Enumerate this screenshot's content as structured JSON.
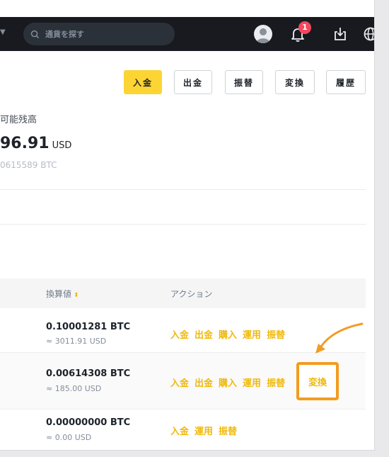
{
  "nav": {
    "search_placeholder": "通貨を探す",
    "notification_count": "1"
  },
  "actions_bar": {
    "deposit": "入金",
    "withdraw": "出金",
    "transfer": "振替",
    "convert": "変換",
    "history": "履歴"
  },
  "balance": {
    "label": "可能残高",
    "value": "96.91",
    "unit": "USD",
    "btc": "0615589 BTC"
  },
  "table": {
    "headers": {
      "converted": "換算値",
      "action": "アクション"
    },
    "rows": [
      {
        "btc": "0.10001281 BTC",
        "usd": "≈ 3011.91 USD",
        "actions": [
          "入金",
          "出金",
          "購入",
          "運用",
          "振替"
        ]
      },
      {
        "btc": "0.00614308 BTC",
        "usd": "≈ 185.00 USD",
        "actions": [
          "入金",
          "出金",
          "購入",
          "運用",
          "振替"
        ],
        "highlighted_action": "変換"
      },
      {
        "btc": "0.00000000 BTC",
        "usd": "≈ 0.00 USD",
        "actions": [
          "入金",
          "運用",
          "振替"
        ]
      }
    ]
  },
  "colors": {
    "navbar": "#181a20",
    "brand_yellow": "#fcd535",
    "action_gold": "#f0b90b",
    "callout_orange": "#f39c1f",
    "badge_red": "#f6465d"
  },
  "icons": [
    "chevron-down-icon",
    "search-icon",
    "avatar",
    "bell-icon",
    "download-icon",
    "globe-icon",
    "sort-icon",
    "arrow-pointer-icon"
  ]
}
